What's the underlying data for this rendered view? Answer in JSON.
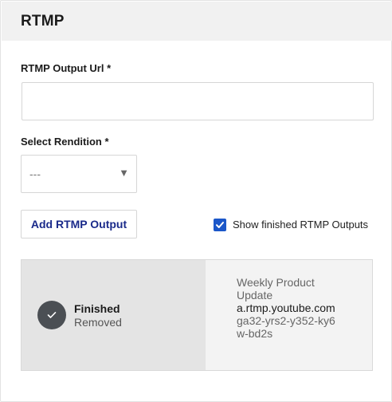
{
  "header": {
    "title": "RTMP"
  },
  "form": {
    "url_label": "RTMP Output Url *",
    "url_value": "",
    "url_placeholder": "",
    "rendition_label": "Select Rendition *",
    "rendition_selected": "---",
    "add_button_label": "Add RTMP Output",
    "show_finished_label": "Show finished RTMP Outputs",
    "show_finished_checked": true
  },
  "outputs": [
    {
      "status": "Finished",
      "substatus": "Removed",
      "name": "Weekly Product Update",
      "host": "a.rtmp.youtube.com",
      "stream_key": "ga32-yrs2-y352-ky6w-bd2s"
    }
  ],
  "colors": {
    "header_bg": "#f1f1f1",
    "accent": "#1b57c9",
    "button_text": "#1a2a8a",
    "status_icon_bg": "#4b4f54"
  }
}
